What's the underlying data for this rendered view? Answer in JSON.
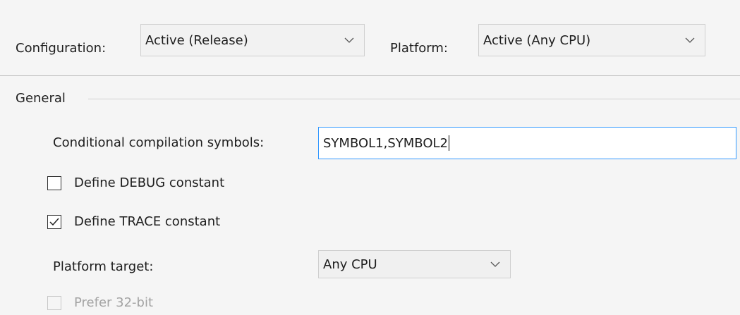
{
  "config_bar": {
    "configuration_label": "Configuration:",
    "configuration_value": "Active (Release)",
    "platform_label": "Platform:",
    "platform_value": "Active (Any CPU)"
  },
  "general": {
    "section_label": "General",
    "conditional_symbols_label": "Conditional compilation symbols:",
    "conditional_symbols_value": "SYMBOL1,SYMBOL2",
    "define_debug_label": "Define DEBUG constant",
    "define_debug_checked": false,
    "define_trace_label": "Define TRACE constant",
    "define_trace_checked": true,
    "platform_target_label": "Platform target:",
    "platform_target_value": "Any CPU",
    "prefer32_label": "Prefer 32-bit",
    "prefer32_enabled": false
  },
  "icons": {
    "dropdown": "chevron-down-icon",
    "check": "check-mark-icon"
  },
  "colors": {
    "background": "#f5f5f5",
    "focus_border": "#3399ff",
    "disabled_text": "#a3a3a3"
  }
}
